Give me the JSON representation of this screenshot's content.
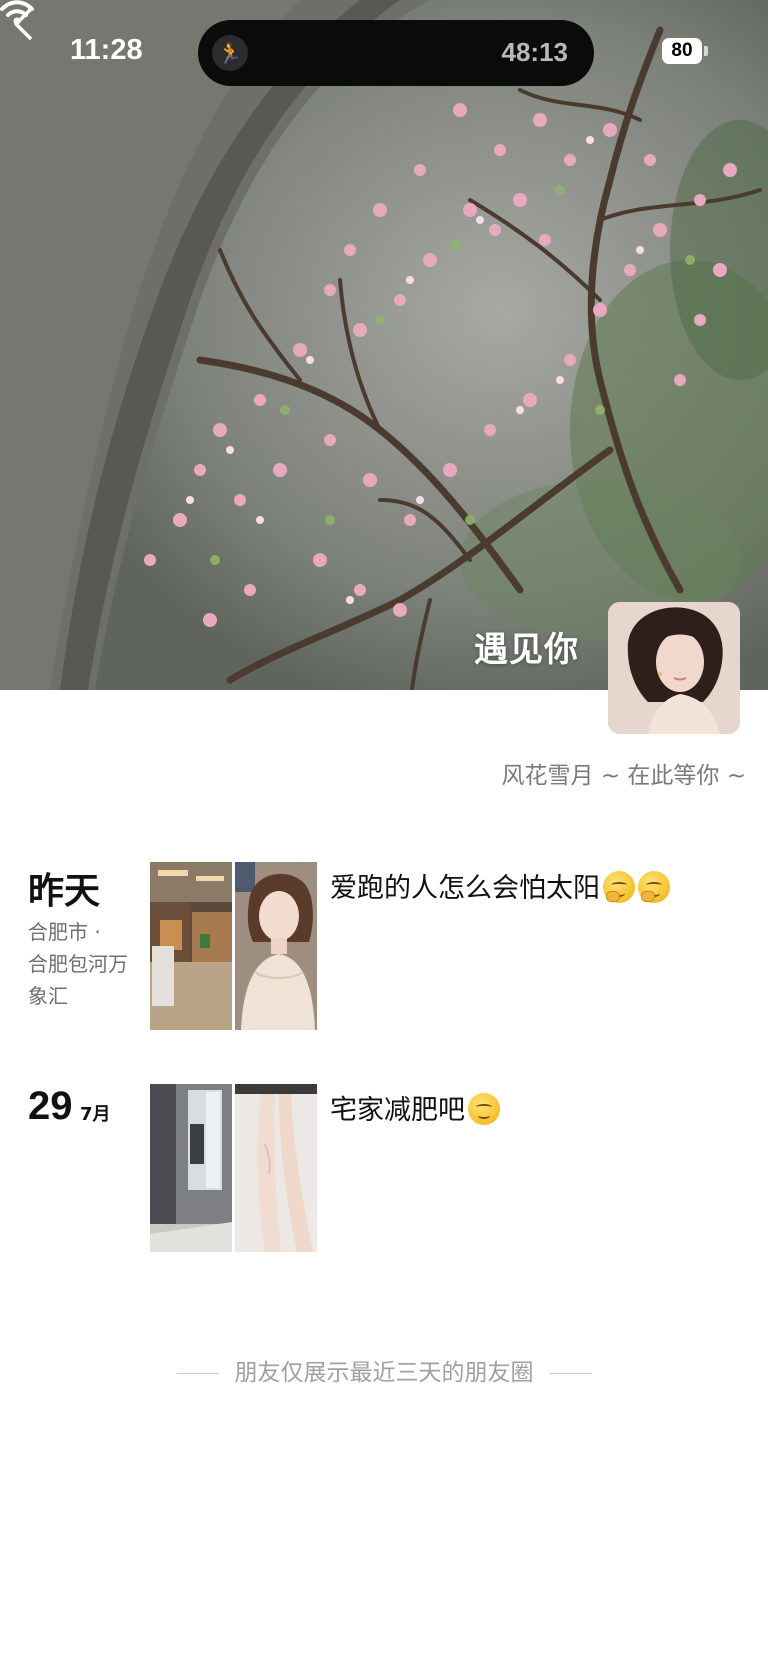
{
  "status_bar": {
    "time": "11:28",
    "activity_timer": "48:13",
    "battery_percent": "80"
  },
  "cover": {
    "title": "遇见你",
    "signature": "风花雪月 ~ 在此等你 ~"
  },
  "posts": [
    {
      "date_label": "昨天",
      "location_line1": "合肥市 ·",
      "location_line2": "合肥包河万",
      "location_line3": "象汇",
      "text": "爱跑的人怎么会怕太阳",
      "emoji_count": 2,
      "emoji_icon": "thinking-face-icon"
    },
    {
      "day": "29",
      "month": "7月",
      "text": "宅家减肥吧",
      "emoji_count": 1,
      "emoji_icon": "smiling-face-icon"
    }
  ],
  "footer": {
    "note": "朋友仅展示最近三天的朋友圈"
  },
  "colors": {
    "background": "#ffffff",
    "muted_text": "#7a7a7a",
    "footer_text": "#a0a0a0",
    "primary_text": "#111111"
  }
}
